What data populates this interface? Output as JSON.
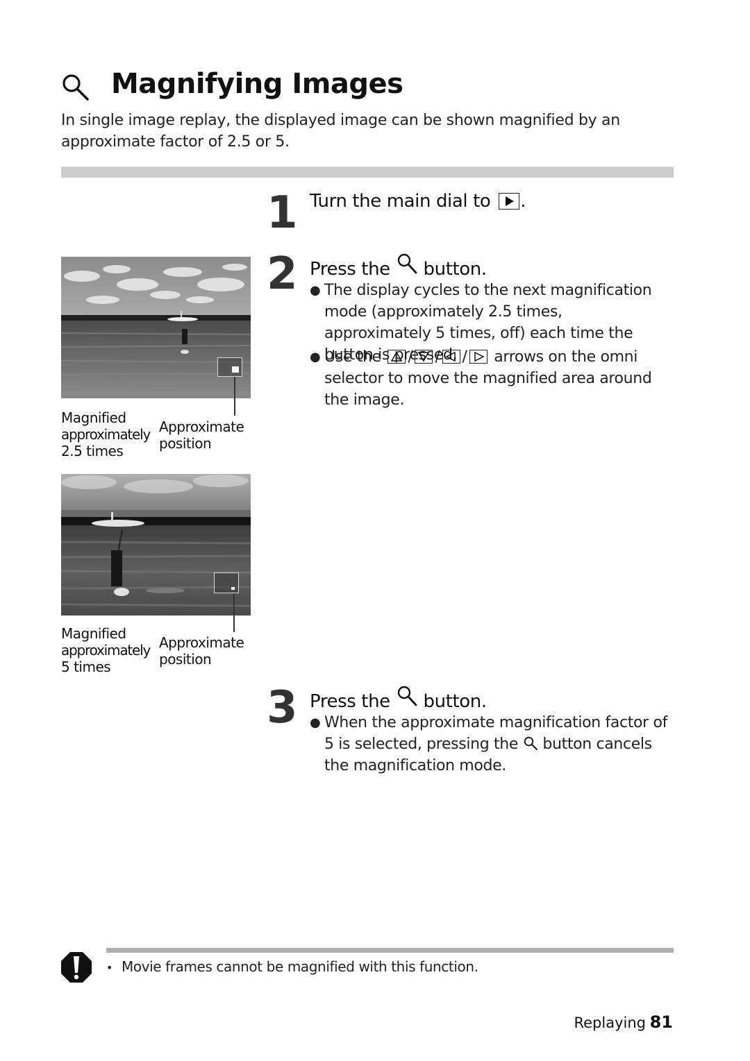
{
  "title": {
    "icon": "magnify-icon",
    "text": "Magnifying Images"
  },
  "intro": "In single image replay, the displayed image can be shown magnified by an approximate factor of 2.5 or 5.",
  "steps": [
    {
      "number": "1",
      "heading_before": "Turn the main dial to",
      "heading_icon": "playback-icon",
      "heading_after": "."
    },
    {
      "number": "2",
      "heading_before": "Press the",
      "heading_icon": "magnify-icon",
      "heading_after": "button.",
      "bullets": [
        {
          "text": "The display cycles to the next magnification mode (approximately 2.5 times, approximately 5 times, off) each time the button is pressed."
        },
        {
          "text_before": "Use the",
          "arrows": [
            "up-arrow-icon",
            "down-arrow-icon",
            "left-arrow-icon",
            "right-arrow-icon"
          ],
          "separator": "/",
          "text_after": "arrows on the omni selector to move the magnified area around the image."
        }
      ]
    },
    {
      "number": "3",
      "heading_before": "Press the",
      "heading_icon": "magnify-icon",
      "heading_after": "button.",
      "bullets": [
        {
          "text_before": "When the approximate magnification factor of 5 is selected, pressing the",
          "icon": "magnify-icon",
          "text_after": "button cancels the magnification mode."
        }
      ]
    }
  ],
  "figures": [
    {
      "caption_left": [
        "Magnified",
        "approximately",
        "2.5 times"
      ],
      "caption_right": [
        "Approximate",
        "position"
      ]
    },
    {
      "caption_left": [
        "Magnified",
        "approximately",
        "5 times"
      ],
      "caption_right": [
        "Approximate",
        "position"
      ]
    }
  ],
  "caution": {
    "icon": "caution-icon",
    "bullet": "•",
    "text": "Movie frames cannot be magnified with this function."
  },
  "footer": {
    "section": "Replaying",
    "page": "81"
  }
}
